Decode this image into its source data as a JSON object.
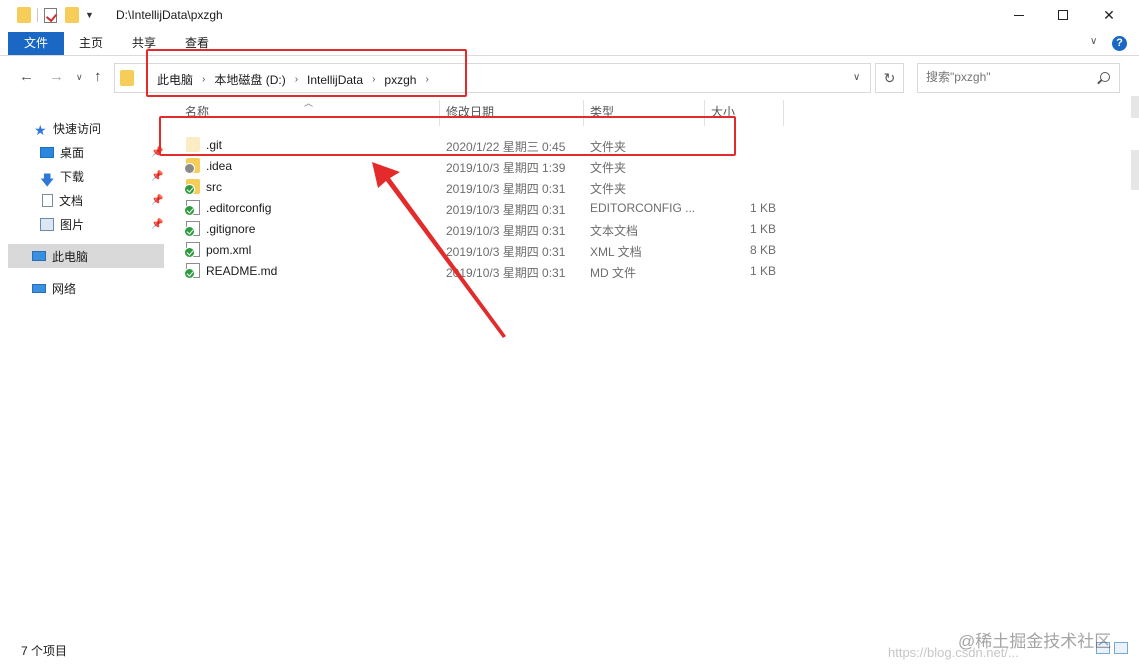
{
  "window": {
    "title_path": "D:\\IntellijData\\pxzgh"
  },
  "ribbon": {
    "tabs": [
      {
        "label": "文件",
        "active": true
      },
      {
        "label": "主页"
      },
      {
        "label": "共享"
      },
      {
        "label": "查看"
      }
    ]
  },
  "address": {
    "breadcrumbs": [
      "此电脑",
      "本地磁盘 (D:)",
      "IntellijData",
      "pxzgh"
    ]
  },
  "search": {
    "placeholder": "搜索\"pxzgh\""
  },
  "sidebar": {
    "items": [
      {
        "label": "快速访问",
        "icon": "star-icon"
      },
      {
        "label": "桌面",
        "icon": "desktop-icon",
        "pinned": true
      },
      {
        "label": "下载",
        "icon": "download-icon",
        "pinned": true
      },
      {
        "label": "文档",
        "icon": "document-icon",
        "pinned": true
      },
      {
        "label": "图片",
        "icon": "picture-icon",
        "pinned": true
      },
      {
        "label": "此电脑",
        "icon": "computer-icon",
        "selected": true
      },
      {
        "label": "网络",
        "icon": "network-icon"
      }
    ]
  },
  "columns": {
    "name": "名称",
    "date": "修改日期",
    "type": "类型",
    "size": "大小"
  },
  "files": [
    {
      "name": ".git",
      "date": "2020/1/22 星期三 0:45",
      "type": "文件夹",
      "size": "",
      "icon": "folder-icon"
    },
    {
      "name": ".idea",
      "date": "2019/10/3 星期四 1:39",
      "type": "文件夹",
      "size": "",
      "icon": "folder-icon"
    },
    {
      "name": "src",
      "date": "2019/10/3 星期四 0:31",
      "type": "文件夹",
      "size": "",
      "icon": "folder-icon"
    },
    {
      "name": ".editorconfig",
      "date": "2019/10/3 星期四 0:31",
      "type": "EDITORCONFIG ...",
      "size": "1 KB",
      "icon": "file-icon"
    },
    {
      "name": ".gitignore",
      "date": "2019/10/3 星期四 0:31",
      "type": "文本文档",
      "size": "1 KB",
      "icon": "file-icon"
    },
    {
      "name": "pom.xml",
      "date": "2019/10/3 星期四 0:31",
      "type": "XML 文档",
      "size": "8 KB",
      "icon": "file-icon"
    },
    {
      "name": "README.md",
      "date": "2019/10/3 星期四 0:31",
      "type": "MD 文件",
      "size": "1 KB",
      "icon": "file-icon"
    }
  ],
  "status": {
    "item_count": "7 个项目"
  },
  "watermark": {
    "line1": "@稀土掘金技术社区",
    "line2": "https://blog.csdn.net/..."
  },
  "colors": {
    "accent": "#1a68c4",
    "annotation": "#e32b2b",
    "folder": "#f7cd5a"
  }
}
